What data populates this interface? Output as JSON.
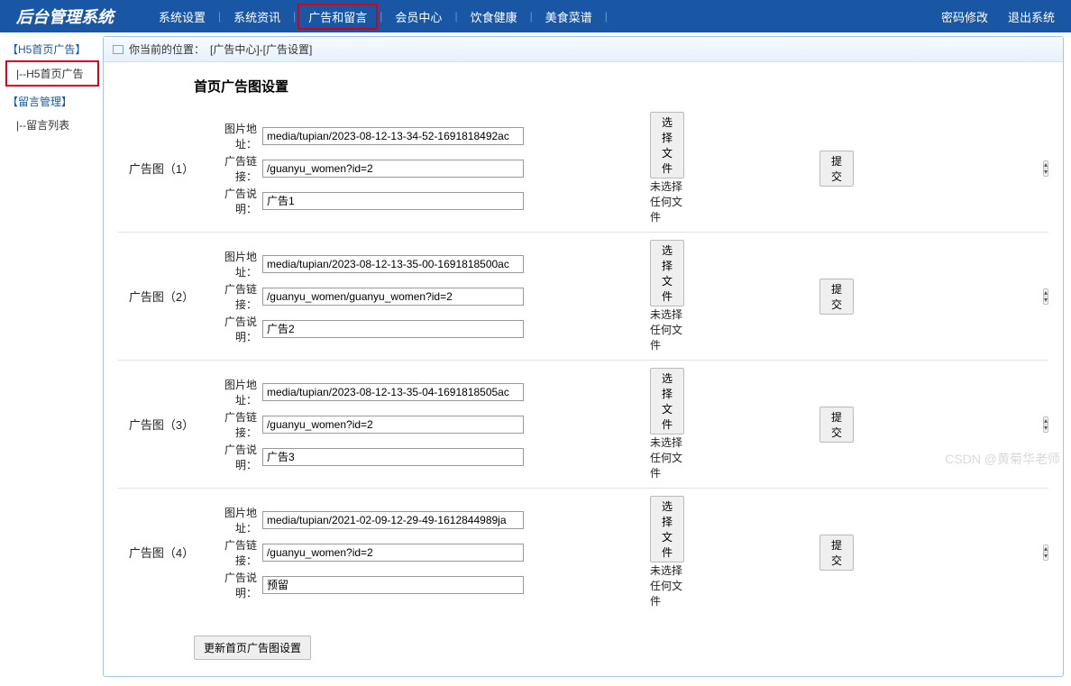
{
  "header": {
    "brand": "后台管理系统",
    "nav": [
      "系统设置",
      "系统资讯",
      "广告和留言",
      "会员中心",
      "饮食健康",
      "美食菜谱"
    ],
    "nav_active_index": 2,
    "right": [
      "密码修改",
      "退出系统"
    ]
  },
  "sidebar": {
    "groups": [
      {
        "title": "【H5首页广告】",
        "items": [
          "|--H5首页广告"
        ],
        "active_item": 0
      },
      {
        "title": "【留言管理】",
        "items": [
          "|--留言列表"
        ],
        "active_item": -1
      }
    ]
  },
  "breadcrumb": {
    "prefix": "你当前的位置：",
    "path": "[广告中心]-[广告设置]"
  },
  "page": {
    "title": "首页广告图设置",
    "field_labels": {
      "image": "图片地址：",
      "link": "广告链接：",
      "desc": "广告说明："
    },
    "file_button": "选择文件",
    "file_empty": "未选择任何文件",
    "submit": "提交",
    "update_button": "更新首页广告图设置",
    "ads": [
      {
        "label": "广告图（1）",
        "image": "media/tupian/2023-08-12-13-34-52-1691818492ac",
        "link": "/guanyu_women?id=2",
        "desc": "广告1"
      },
      {
        "label": "广告图（2）",
        "image": "media/tupian/2023-08-12-13-35-00-1691818500ac",
        "link": "/guanyu_women/guanyu_women?id=2",
        "desc": "广告2"
      },
      {
        "label": "广告图（3）",
        "image": "media/tupian/2023-08-12-13-35-04-1691818505ac",
        "link": "/guanyu_women?id=2",
        "desc": "广告3"
      },
      {
        "label": "广告图（4）",
        "image": "media/tupian/2021-02-09-12-29-49-1612844989ja",
        "link": "/guanyu_women?id=2",
        "desc": "预留"
      }
    ]
  },
  "watermark": "CSDN @黄菊华老师"
}
